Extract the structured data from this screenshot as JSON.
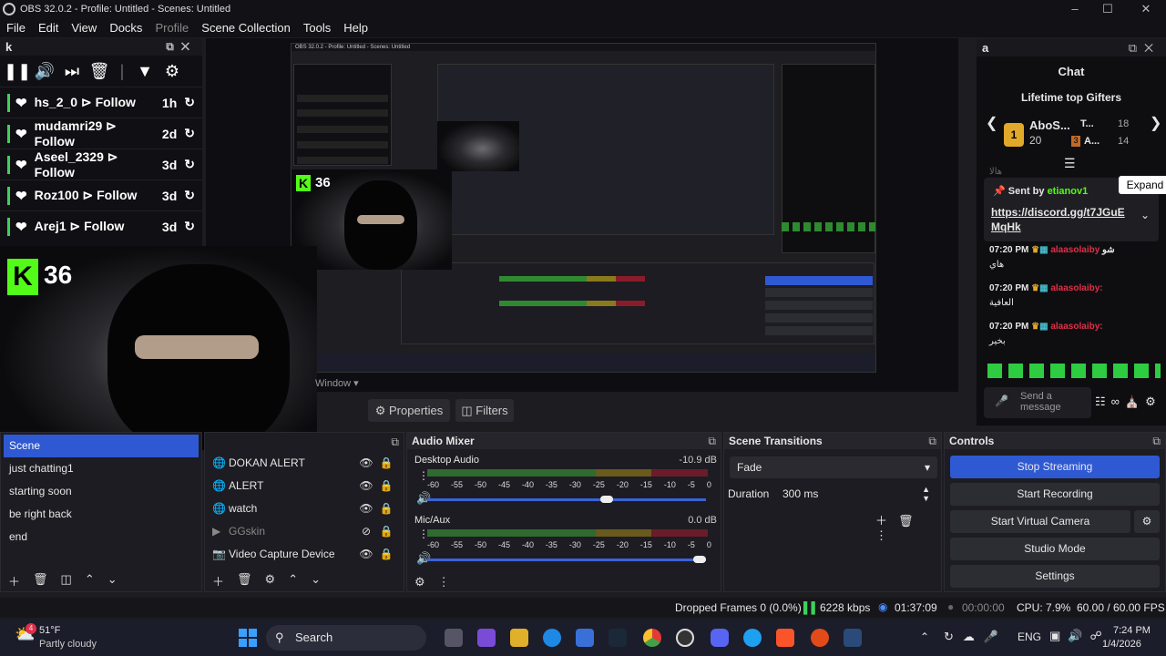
{
  "window": {
    "title": "OBS 32.0.2 - Profile: Untitled - Scenes: Untitled"
  },
  "menu": [
    "File",
    "Edit",
    "View",
    "Docks",
    "Profile",
    "Scene Collection",
    "Tools",
    "Help"
  ],
  "follows_dock": {
    "title": "k",
    "rows": [
      {
        "name": "hs_2_0 ⊳ Follow",
        "time": "1h"
      },
      {
        "name": "mudamri29 ⊳ Follow",
        "time": "2d"
      },
      {
        "name": "Aseel_2329 ⊳ Follow",
        "time": "3d"
      },
      {
        "name": "Roz100 ⊳ Follow",
        "time": "3d"
      },
      {
        "name": "Arej1 ⊳ Follow",
        "time": "3d"
      }
    ]
  },
  "overlay": {
    "badge": "K",
    "count": "36",
    "window_label": "Window"
  },
  "props": {
    "properties": "Properties",
    "filters": "Filters"
  },
  "chat_dock": {
    "title": "a",
    "header": "Chat",
    "gifters_title": "Lifetime top Gifters",
    "gifter1": {
      "name": "AboS...",
      "count": "20",
      "rank": "1"
    },
    "gifter2": {
      "name": "T...",
      "count": "18"
    },
    "gifter3": {
      "name": "A...",
      "count": "14",
      "rank": "3"
    },
    "faded": "هالا",
    "pinned_by": "Sent by",
    "pinned_user": "etianov1",
    "expand": "Expand",
    "pinned_link": "https://discord.gg/t7JGuE MqHk",
    "messages": [
      {
        "time": "07:20 PM",
        "user": "alaasolaiby",
        "text": "هاي",
        "suffix": "شو"
      },
      {
        "time": "07:20 PM",
        "user": "alaasolaiby:",
        "text": "العافية"
      },
      {
        "time": "07:20 PM",
        "user": "alaasolaiby:",
        "text": "بخير"
      }
    ],
    "input_placeholder": "Send a message"
  },
  "scenes": {
    "items": [
      "Scene",
      "just chatting1",
      "starting soon",
      "be right back",
      "end"
    ],
    "selected": 0
  },
  "sources": {
    "items": [
      "DOKAN ALERT",
      "ALERT",
      "watch",
      "GGskin",
      "Video Capture Device"
    ]
  },
  "mixer": {
    "title": "Audio Mixer",
    "tracks": [
      {
        "name": "Desktop Audio",
        "db": "-10.9 dB",
        "fader": 0.65
      },
      {
        "name": "Mic/Aux",
        "db": "0.0 dB",
        "fader": 1.0
      }
    ],
    "ticks": [
      "-60",
      "-55",
      "-50",
      "-45",
      "-40",
      "-35",
      "-30",
      "-25",
      "-20",
      "-15",
      "-10",
      "-5",
      "0"
    ]
  },
  "transitions": {
    "title": "Scene Transitions",
    "type": "Fade",
    "duration_label": "Duration",
    "duration": "300 ms"
  },
  "controls": {
    "title": "Controls",
    "buttons": [
      "Stop Streaming",
      "Start Recording",
      "Start Virtual Camera",
      "Studio Mode",
      "Settings"
    ]
  },
  "status": {
    "dropped": "Dropped Frames 0 (0.0%)",
    "kbps": "6228 kbps",
    "stream_time": "01:37:09",
    "rec_time": "00:00:00",
    "cpu": "CPU: 7.9%",
    "fps": "60.00 / 60.00 FPS"
  },
  "taskbar": {
    "weather_temp": "51°F",
    "weather_desc": "Partly cloudy",
    "weather_badge": "4",
    "search": "Search",
    "lang": "ENG",
    "time": "7:24 PM",
    "date": "1/4/2026"
  },
  "colors": {
    "accent": "#2f59d2",
    "kick_green": "#53fc18",
    "meter_green": "#2f8a2f",
    "meter_yellow": "#8a7a1c",
    "meter_red": "#8a1c2a"
  }
}
